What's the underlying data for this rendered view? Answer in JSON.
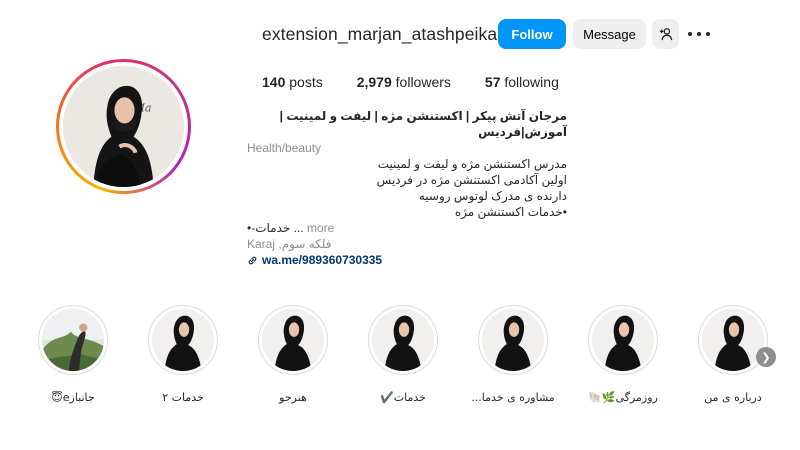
{
  "profile": {
    "username": "extension_marjan_atashpeikar",
    "follow_label": "Follow",
    "message_label": "Message",
    "add_user_icon": "add-user-icon",
    "more_icon": "more-dots-icon"
  },
  "stats": {
    "posts_count": "140",
    "posts_label": "posts",
    "followers_count": "2,979",
    "followers_label": "followers",
    "following_count": "57",
    "following_label": "following"
  },
  "bio": {
    "name": "مرجان آتش پیکر | اکستنشن مژه | لیفت و لمینیت | آموزش|فردیس",
    "category": "Health/beauty",
    "lines": [
      "مدرس اکستنشن مژه و لیفت و لمینیت",
      "اولین آکادمی اکستنشن مژه در فردیس",
      "دارنده ی مدرک لوتوس روسیه",
      "•خدمات اکستنشن مژه"
    ],
    "truncated_line": "•-خدمات",
    "ellipsis": "...",
    "more_label": "more",
    "location": "Karaj ,فلکه سوم",
    "link": "wa.me/989360730335"
  },
  "highlights": [
    {
      "label": "جانبازe😇"
    },
    {
      "label": "خدمات ۲"
    },
    {
      "label": "هنرجو"
    },
    {
      "label": "خدمات✔️"
    },
    {
      "label": "مشاوره ی خدما..."
    },
    {
      "label": "روزمرگی🌿🐚"
    },
    {
      "label": "درباره ی من"
    }
  ],
  "colors": {
    "follow_button": "#0095f6",
    "link": "#00376b",
    "secondary_text": "#8e8e8e"
  }
}
